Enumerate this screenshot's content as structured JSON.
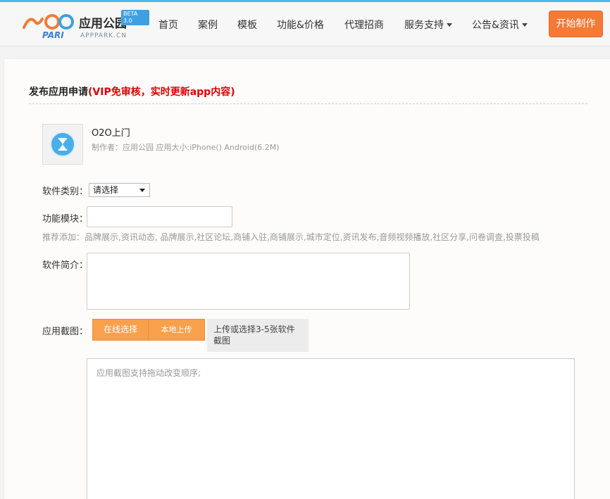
{
  "header": {
    "logo_cn": "应用公园",
    "logo_brand": "PARI",
    "logo_domain": "APPPARK.CN",
    "logo_badge": "BETA 3.0",
    "nav": [
      {
        "label": "首页"
      },
      {
        "label": "案例"
      },
      {
        "label": "模板"
      },
      {
        "label": "功能&价格"
      },
      {
        "label": "代理招商"
      },
      {
        "label": "服务支持",
        "dropdown": true
      },
      {
        "label": "公告&资讯",
        "dropdown": true
      }
    ],
    "cta_label": "开始制作"
  },
  "form": {
    "title_main": "发布应用申请",
    "title_note": "(VIP免审核，实时更新app内容)",
    "app": {
      "name": "O2O上门",
      "meta": "制作者：应用公园    应用大小:iPhone() Android(6.2M)",
      "icon": "hourglass-icon"
    },
    "category_label": "软件类别：",
    "category_value": "请选择",
    "module_label": "功能模块：",
    "module_value": "",
    "recommend_hint": "推荐添加：品牌展示,资讯动态, 品牌展示,社区论坛,商铺入驻,商铺展示,城市定位,资讯发布,音频视频播放,社区分享,问卷调查,投票投稿",
    "intro_label": "软件简介：",
    "intro_value": "",
    "screenshot_label": "应用截图：",
    "online_select_label": "在线选择",
    "local_upload_label": "本地上传",
    "upload_tip": "上传或选择3-5张软件截图",
    "screenshot_placeholder": "应用截图支持拖动改变顺序;"
  },
  "colors": {
    "accent_orange": "#f47a35",
    "button_orange": "#f9a04c",
    "highlight_red": "#e00000",
    "top_bar_blue": "#4db8f0"
  }
}
